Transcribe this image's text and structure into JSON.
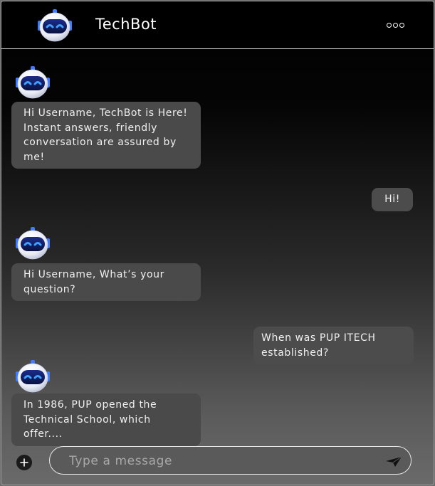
{
  "header": {
    "title": "TechBot",
    "menu_icon": "more-options-icon",
    "avatar_icon": "robot-avatar-icon"
  },
  "messages": [
    {
      "sender": "bot",
      "text": "Hi Username, TechBot is Here! Instant answers, friendly conversation are assured by me!"
    },
    {
      "sender": "user",
      "text": "Hi!"
    },
    {
      "sender": "bot",
      "text": "Hi Username, What’s your question?"
    },
    {
      "sender": "user",
      "text": "When was PUP ITECH established?"
    },
    {
      "sender": "bot",
      "text": "In 1986, PUP opened the Technical School, which offer...."
    }
  ],
  "composer": {
    "placeholder": "Type a message",
    "value": "",
    "add_icon": "plus-icon",
    "send_icon": "send-icon"
  },
  "colors": {
    "accent": "#2f7bff",
    "bubble": "#4a4a4a",
    "header_bg": "#000000"
  }
}
